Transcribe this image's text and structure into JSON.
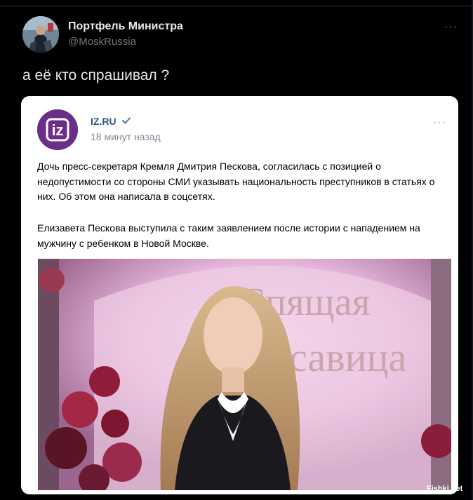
{
  "tweet": {
    "author_name": "Портфель Министра",
    "author_handle": "@MoskRussia",
    "text": "а её кто спрашивал ?",
    "more_label": "···"
  },
  "card": {
    "source_name": "IZ.RU",
    "time": "18 минут назад",
    "more_label": "···",
    "paragraph1": "Дочь пресс-секретаря Кремля Дмитрия Пескова, согласилась с позицией о недопустимости со стороны СМИ указывать национальность преступников в статьях о них. Об этом она написала в соцсетях.",
    "paragraph2": "Елизавета Пескова выступила с таким заявлением после истории с нападением на мужчину с ребенком в Новой Москве.",
    "logo_text": "iz",
    "photo_sign_line1": "Спящая",
    "photo_sign_line2": "Красавица"
  },
  "watermark": "Fishki.net",
  "colors": {
    "background": "#000000",
    "card": "#ffffff",
    "link": "#2a5885",
    "logo": "#6b2f8a",
    "verified": "#4a76a8"
  }
}
